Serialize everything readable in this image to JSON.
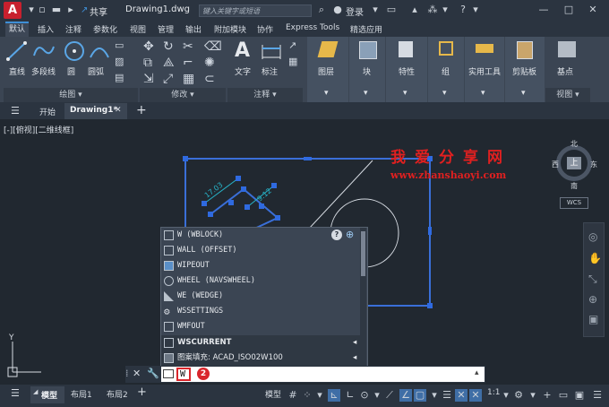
{
  "titlebar": {
    "logo": "A",
    "share": "共享",
    "doc_title": "Drawing1.dwg",
    "search_placeholder": "键入关键字或短语",
    "login": "登录"
  },
  "ribbon_tabs": [
    "默认",
    "插入",
    "注释",
    "参数化",
    "视图",
    "管理",
    "输出",
    "附加模块",
    "协作",
    "Express Tools",
    "精选应用"
  ],
  "ribbon": {
    "draw": {
      "line": "直线",
      "polyline": "多段线",
      "circle": "圆",
      "arc": "圆弧",
      "panel": "绘图"
    },
    "modify": {
      "panel": "修改"
    },
    "annotation": {
      "text": "文字",
      "dimension": "标注",
      "panel": "注释"
    },
    "layers": "图层",
    "block": "块",
    "properties": "特性",
    "groups": "组",
    "utilities": "实用工具",
    "clipboard": "剪贴板",
    "base": "基点",
    "view_panel": "视图"
  },
  "doc_tabs": {
    "start": "开始",
    "drawing": "Drawing1*"
  },
  "viewport_label": "[-][俯视][二维线框]",
  "watermark": {
    "line1": "我爱分享网",
    "line2": "www.zhanshaoyi.com"
  },
  "viewcube": {
    "north": "北",
    "south": "南",
    "west": "西",
    "east": "东",
    "top": "上",
    "wcs": "WCS"
  },
  "dims": {
    "a": "17.03",
    "b": "9.12"
  },
  "autocomplete": [
    {
      "label": "W (WBLOCK)",
      "icon": "wblock-icon"
    },
    {
      "label": "WALL (OFFSET)",
      "icon": "offset-icon"
    },
    {
      "label": "WIPEOUT",
      "icon": "wipeout-icon"
    },
    {
      "label": "WHEEL (NAVSWHEEL)",
      "icon": "wheel-icon"
    },
    {
      "label": "WE (WEDGE)",
      "icon": "wedge-icon"
    },
    {
      "label": "WSSETTINGS",
      "icon": "gear-icon"
    },
    {
      "label": "WMFOUT",
      "icon": "wmf-icon"
    }
  ],
  "autocomplete_groups": [
    {
      "label": "WSCURRENT"
    },
    {
      "label": "图案填充: ACAD_ISO02W100"
    }
  ],
  "command": {
    "input": "W",
    "badge": "2"
  },
  "status": {
    "model_tab": "模型",
    "layout1": "布局1",
    "layout2": "布局2",
    "model_btn": "模型",
    "scale": "1:1"
  },
  "accent_color": "#3f8fd6",
  "select_color": "#3a6fd8",
  "badge_color": "#d9262c"
}
